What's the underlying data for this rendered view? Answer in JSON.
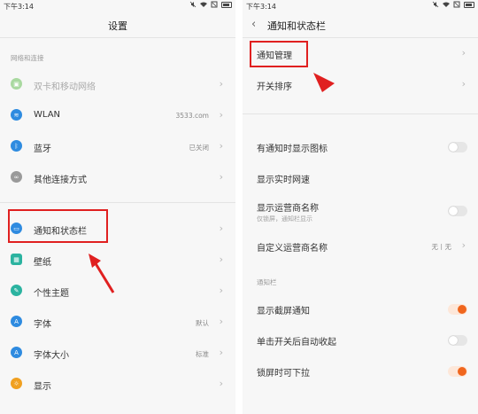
{
  "left": {
    "status": {
      "time": "下午3:14"
    },
    "title": "设置",
    "section_network": "网络和连接",
    "items": [
      {
        "label": "双卡和移动网络",
        "value": "",
        "icon": "sim-icon",
        "color": "#7cc46a",
        "dim": true
      },
      {
        "label": "WLAN",
        "value": "3533.com",
        "icon": "wifi-icon",
        "color": "#2e8be0"
      },
      {
        "label": "蓝牙",
        "value": "已关闭",
        "icon": "bluetooth-icon",
        "color": "#2e8be0"
      },
      {
        "label": "其他连接方式",
        "value": "",
        "icon": "link-icon",
        "color": "#9a9a9a"
      },
      {
        "label": "通知和状态栏",
        "value": "",
        "icon": "notification-icon",
        "color": "#2e8be0"
      },
      {
        "label": "壁纸",
        "value": "",
        "icon": "wallpaper-icon",
        "color": "#2bb3a0"
      },
      {
        "label": "个性主题",
        "value": "",
        "icon": "theme-icon",
        "color": "#2bb3a0"
      },
      {
        "label": "字体",
        "value": "默认",
        "icon": "font-icon",
        "color": "#2e8be0"
      },
      {
        "label": "字体大小",
        "value": "标准",
        "icon": "font-size-icon",
        "color": "#2e8be0"
      },
      {
        "label": "显示",
        "value": "",
        "icon": "display-icon",
        "color": "#f0a020"
      }
    ]
  },
  "right": {
    "status": {
      "time": "下午3:14"
    },
    "title": "通知和状态栏",
    "rows": [
      {
        "label": "通知管理",
        "type": "chevron"
      },
      {
        "label": "开关排序",
        "type": "chevron"
      },
      {
        "label": "有通知时显示图标",
        "type": "toggle",
        "on": false
      },
      {
        "label": "显示实时网速",
        "type": "none"
      },
      {
        "label": "显示运营商名称",
        "sub": "仅锁屏，通知栏显示",
        "type": "toggle",
        "on": false
      },
      {
        "label": "自定义运营商名称",
        "value": "无丨无",
        "type": "chevron"
      }
    ],
    "section_notify": "通知栏",
    "rows2": [
      {
        "label": "显示截屏通知",
        "type": "toggle",
        "on": true
      },
      {
        "label": "单击开关后自动收起",
        "type": "toggle",
        "on": false
      },
      {
        "label": "锁屏时可下拉",
        "type": "toggle",
        "on": true
      }
    ]
  },
  "colors": {
    "highlight": "#e02020",
    "accent": "#f0661e"
  }
}
